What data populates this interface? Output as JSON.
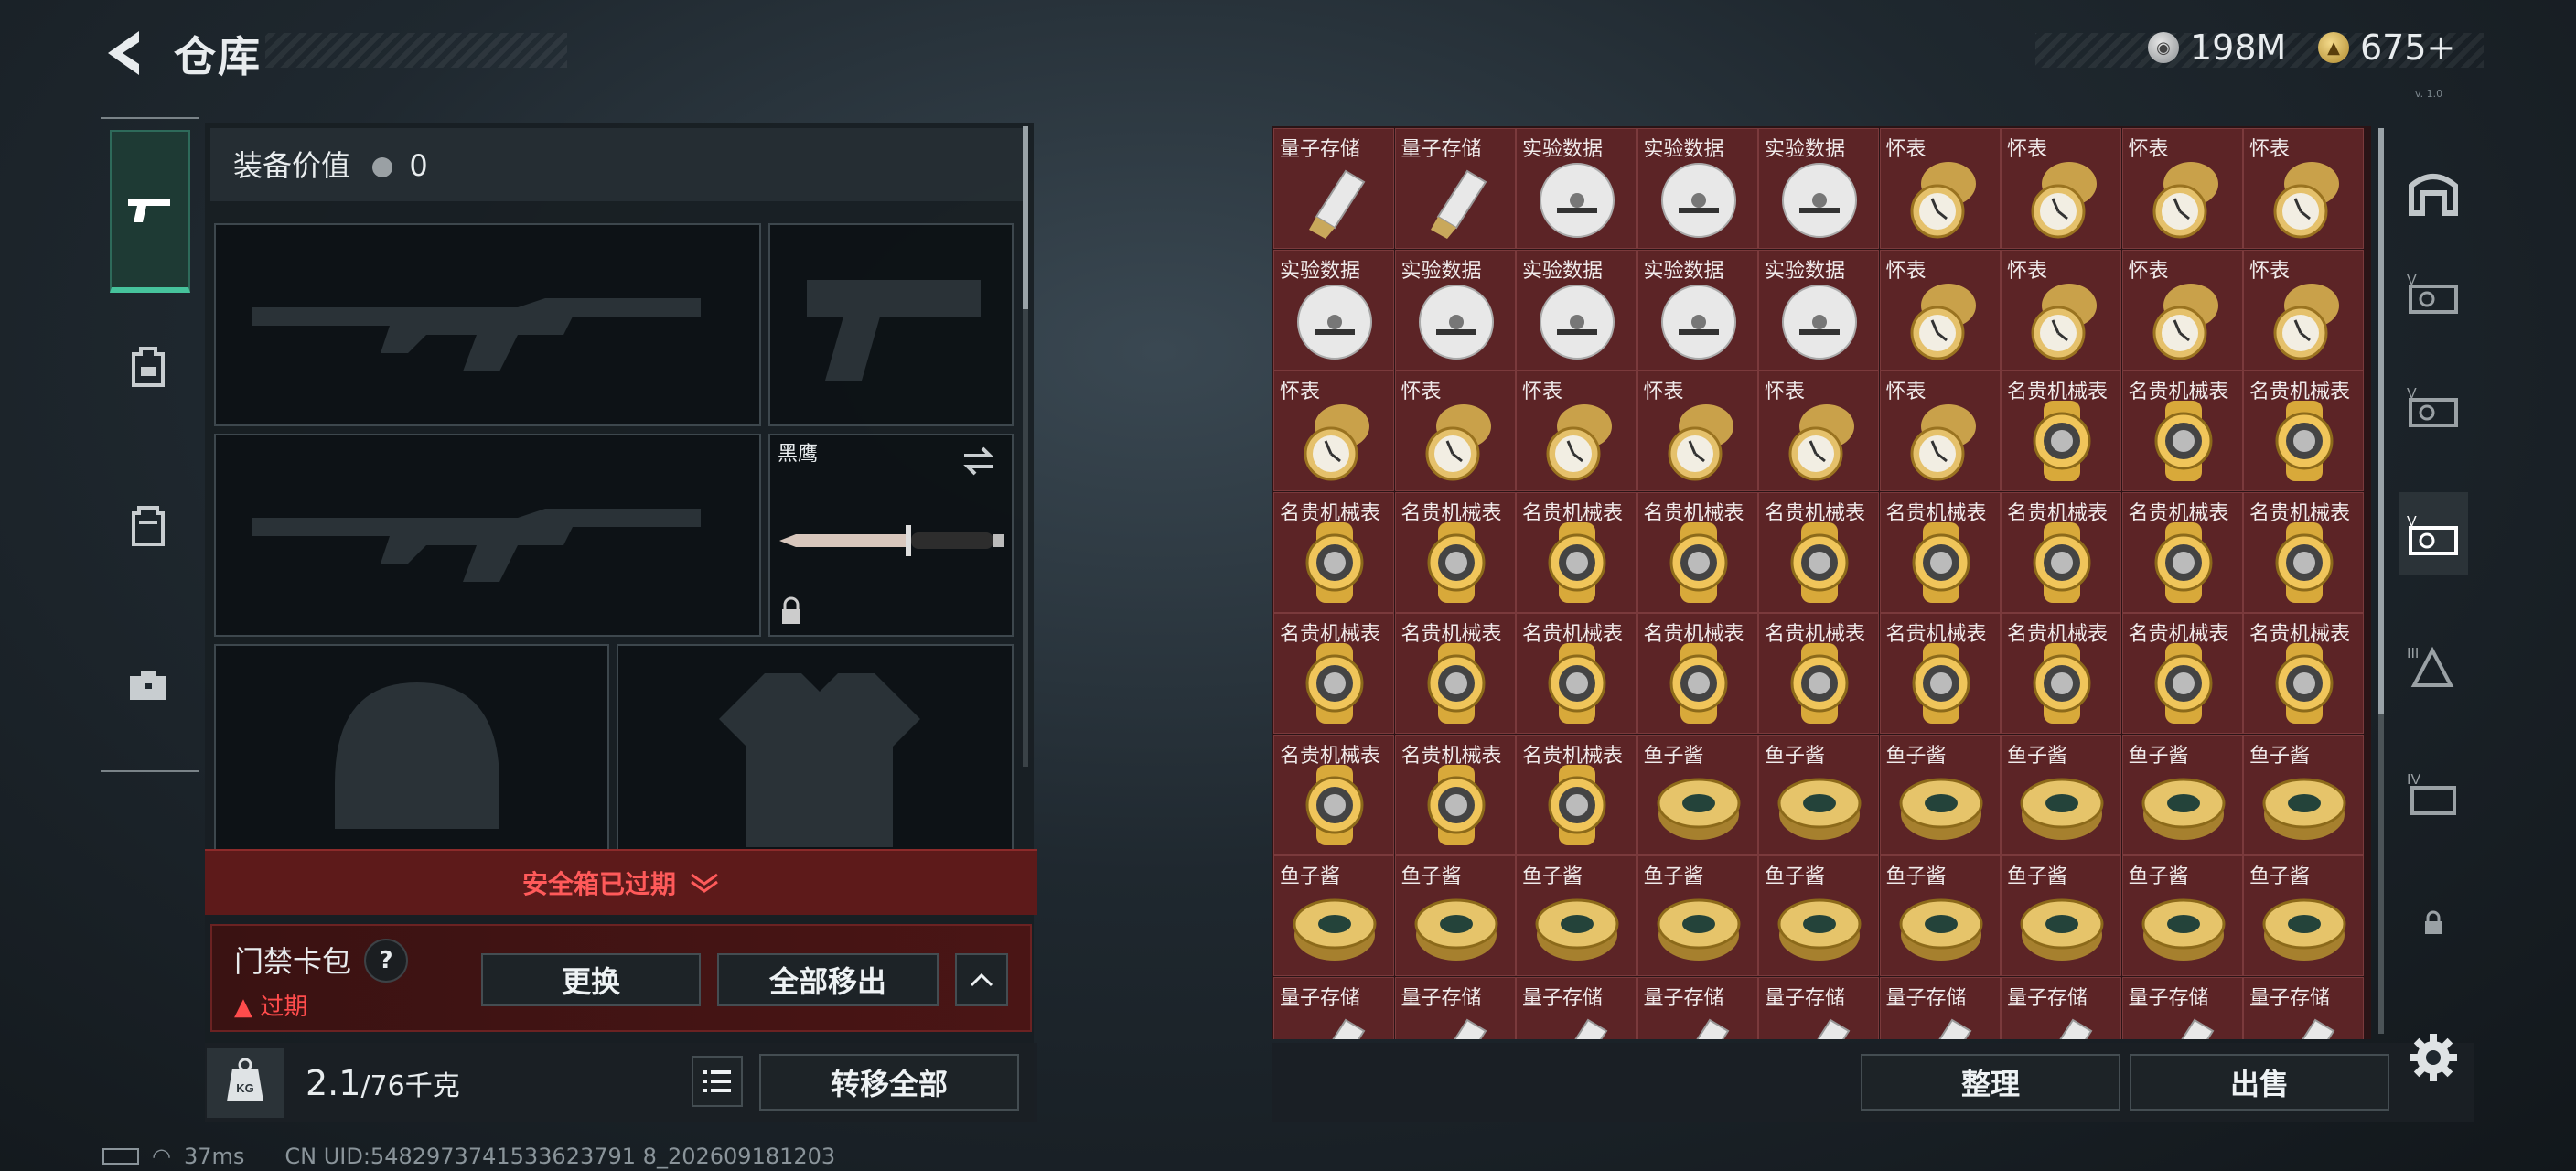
{
  "header": {
    "title": "仓库"
  },
  "currency": {
    "silver": "198M",
    "gold": "675+"
  },
  "build": "v. 1.0",
  "equipment": {
    "value_label": "装备价值",
    "value": "0",
    "knife_name": "黑鹰"
  },
  "safebox": {
    "expired_label": "安全箱已过期",
    "cardpack_title": "门禁卡包",
    "help_glyph": "?",
    "status": "过期",
    "replace_label": "更换",
    "move_all_label": "全部移出"
  },
  "weight": {
    "current": "2.1",
    "max": "/76千克",
    "transfer_label": "转移全部"
  },
  "inventory": {
    "items": [
      "量子存储",
      "量子存储",
      "实验数据",
      "实验数据",
      "实验数据",
      "怀表",
      "怀表",
      "怀表",
      "怀表",
      "实验数据",
      "实验数据",
      "实验数据",
      "实验数据",
      "实验数据",
      "怀表",
      "怀表",
      "怀表",
      "怀表",
      "怀表",
      "怀表",
      "怀表",
      "怀表",
      "怀表",
      "怀表",
      "名贵机械表",
      "名贵机械表",
      "名贵机械表",
      "名贵机械表",
      "名贵机械表",
      "名贵机械表",
      "名贵机械表",
      "名贵机械表",
      "名贵机械表",
      "名贵机械表",
      "名贵机械表",
      "名贵机械表",
      "名贵机械表",
      "名贵机械表",
      "名贵机械表",
      "名贵机械表",
      "名贵机械表",
      "名贵机械表",
      "名贵机械表",
      "名贵机械表",
      "名贵机械表",
      "名贵机械表",
      "名贵机械表",
      "名贵机械表",
      "鱼子酱",
      "鱼子酱",
      "鱼子酱",
      "鱼子酱",
      "鱼子酱",
      "鱼子酱",
      "鱼子酱",
      "鱼子酱",
      "鱼子酱",
      "鱼子酱",
      "鱼子酱",
      "鱼子酱",
      "鱼子酱",
      "鱼子酱",
      "鱼子酱",
      "量子存储",
      "量子存储",
      "量子存储",
      "量子存储",
      "量子存储",
      "量子存储",
      "量子存储",
      "量子存储",
      "量子存储"
    ],
    "sort_label": "整理",
    "sell_label": "出售"
  },
  "status": {
    "ping": "37ms",
    "uid": "CN UID:5482973741533623791 8_202609181203"
  },
  "colors": {
    "accent": "#46c39c",
    "cell": "#5c2426",
    "expired": "#ff5a5a"
  }
}
